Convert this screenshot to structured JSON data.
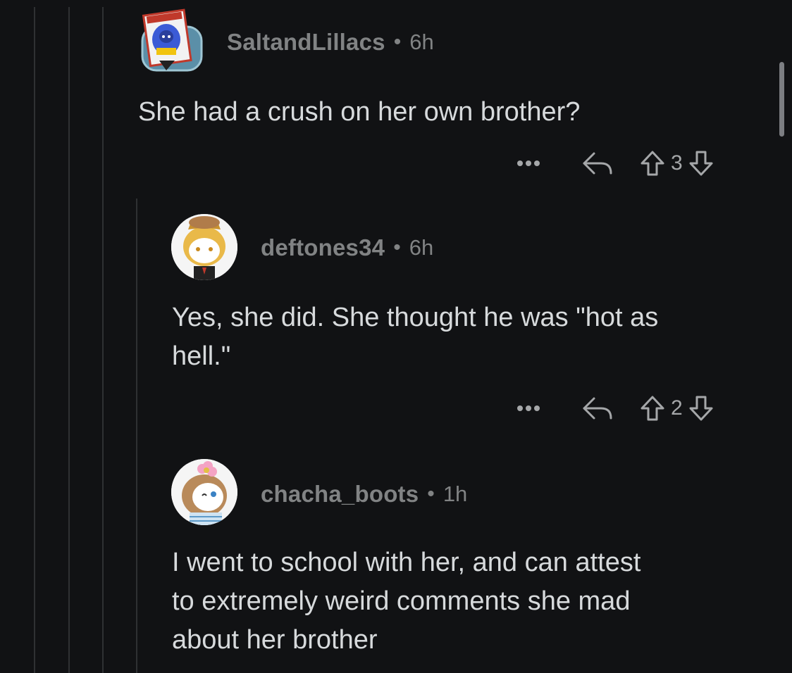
{
  "comments": [
    {
      "username": "SaltandLillacs",
      "separator": "•",
      "time": "6h",
      "body_lines": [
        "She had a crush on her own brother?"
      ],
      "votes": "3",
      "avatar": "snoo-avatar-blue-hood"
    },
    {
      "username": "deftones34",
      "separator": "•",
      "time": "6h",
      "body_lines": [
        "Yes, she did. She thought he was \"hot as",
        "hell.\""
      ],
      "votes": "2",
      "avatar": "snoo-avatar-shiba-hood"
    },
    {
      "username": "chacha_boots",
      "separator": "•",
      "time": "1h",
      "body_lines": [
        "I went to school with her, and can attest",
        "to extremely weird comments she mad",
        "about her brother"
      ],
      "avatar": "snoo-avatar-flower-hair"
    }
  ],
  "icons": {
    "more": "more-options-icon",
    "reply": "reply-icon",
    "upvote": "upvote-icon",
    "downvote": "downvote-icon"
  },
  "colors": {
    "background": "#111214",
    "text": "#d7dadc",
    "meta": "#818384",
    "thread_line": "#2f3133"
  }
}
